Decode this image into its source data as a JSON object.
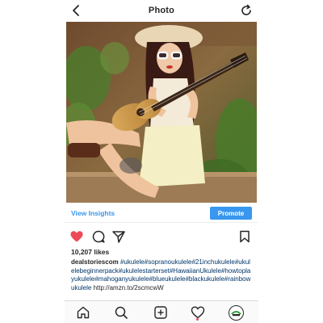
{
  "header": {
    "title": "Photo"
  },
  "insights": {
    "view_label": "View Insights",
    "promote_label": "Promote"
  },
  "post": {
    "likes": "10,207 likes",
    "username": "dealstoriescom",
    "caption_tags": "#ukulele#sopranoukulele#21inchukulele#ukulelebeginnerpack#ukulelestarterset#HawaiianUkulele#howtoplayukulele#mahoganyukulele#blueukulele#blackukulele#rainbowukulele",
    "link": "http://amzn.to/2scmcwW",
    "liked": true
  },
  "icons": {
    "header": [
      "chevron-left-icon",
      "refresh-icon"
    ],
    "actions": [
      "heart-icon",
      "comment-icon",
      "share-icon",
      "bookmark-icon"
    ],
    "bottom_nav": [
      "home-icon",
      "search-icon",
      "add-post-icon",
      "activity-heart-icon",
      "profile-avatar"
    ]
  },
  "colors": {
    "accent_blue": "#3897f0",
    "like_red": "#ed4956",
    "hashtag_blue": "#003569",
    "text_dark": "#262626"
  }
}
